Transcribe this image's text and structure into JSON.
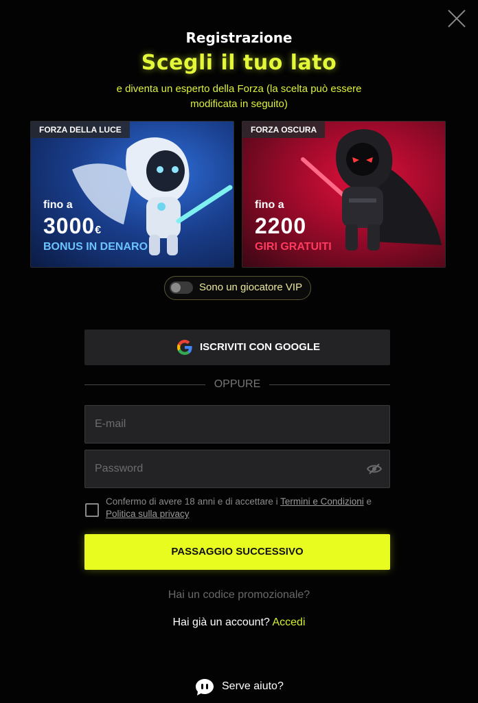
{
  "header": {
    "title": "Registrazione",
    "headline": "Scegli il tuo lato",
    "subtitle": "e diventa un esperto della Forza (la scelta può essere modificata in seguito)"
  },
  "cards": {
    "light": {
      "tag": "FORZA DELLA LUCE",
      "up_to": "fino a",
      "amount": "3000",
      "currency": "€",
      "bonus": "BONUS IN DENARO",
      "color": "#6cc3ff"
    },
    "dark": {
      "tag": "FORZA OSCURA",
      "up_to": "fino a",
      "amount": "2200",
      "bonus": "GIRI GRATUITI",
      "color": "#ff3b5f"
    }
  },
  "vip": {
    "label": "Sono un giocatore VIP",
    "enabled": false
  },
  "google_button": {
    "label": "ISCRIVITI CON GOOGLE",
    "icon": "google-icon"
  },
  "divider": {
    "label": "OPPURE"
  },
  "form": {
    "email_placeholder": "E-mail",
    "password_placeholder": "Password",
    "consent_prefix": "Confermo di avere 18 anni e di accettare i ",
    "terms_link": "Termini e Condizioni",
    "consent_mid": " e ",
    "privacy_link": "Politica sulla privacy",
    "checked": false
  },
  "next_button": {
    "label": "PASSAGGIO SUCCESSIVO",
    "color": "#e8fc1f"
  },
  "promo": {
    "label": "Hai un codice promozionale?"
  },
  "account": {
    "prompt": "Hai già un account?",
    "login_label": "Accedi"
  },
  "help": {
    "label": "Serve aiuto?",
    "icon": "chat-icon"
  },
  "colors": {
    "accent": "#e4f83a",
    "background": "#030303",
    "field_background": "#232325"
  }
}
